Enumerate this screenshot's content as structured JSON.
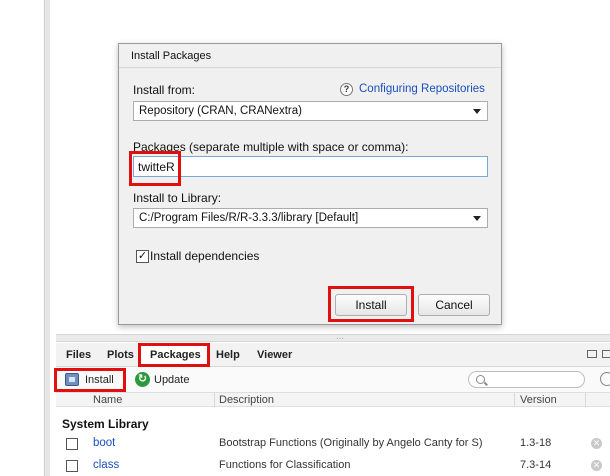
{
  "dialog": {
    "title": "Install Packages",
    "install_from_label": "Install from:",
    "help_link": "Configuring Repositories",
    "help_icon": "?",
    "repository_value": "Repository (CRAN, CRANextra)",
    "packages_label": "Packages (separate multiple with space or comma):",
    "packages_value": "twitteR",
    "library_label": "Install to Library:",
    "library_value": "C:/Program Files/R/R-3.3.3/library [Default]",
    "dependencies_label": "Install dependencies",
    "dependencies_checked": true,
    "install_button": "Install",
    "cancel_button": "Cancel"
  },
  "pane": {
    "tabs": [
      "Files",
      "Plots",
      "Packages",
      "Help",
      "Viewer"
    ],
    "active_tab": "Packages",
    "toolbar": {
      "install": "Install",
      "update": "Update"
    },
    "columns": {
      "name": "Name",
      "description": "Description",
      "version": "Version"
    },
    "section": "System Library",
    "packages": [
      {
        "name": "boot",
        "description": "Bootstrap Functions (Originally by Angelo Canty for S)",
        "version": "1.3-18"
      },
      {
        "name": "class",
        "description": "Functions for Classification",
        "version": "7.3-14"
      }
    ]
  },
  "colors": {
    "highlight": "#e01010",
    "link": "#1a4fbf",
    "update_icon": "#2c9a3c"
  },
  "icons": {
    "install": "package-icon",
    "update": "update-icon",
    "search": "search-icon",
    "remove": "remove-icon"
  }
}
